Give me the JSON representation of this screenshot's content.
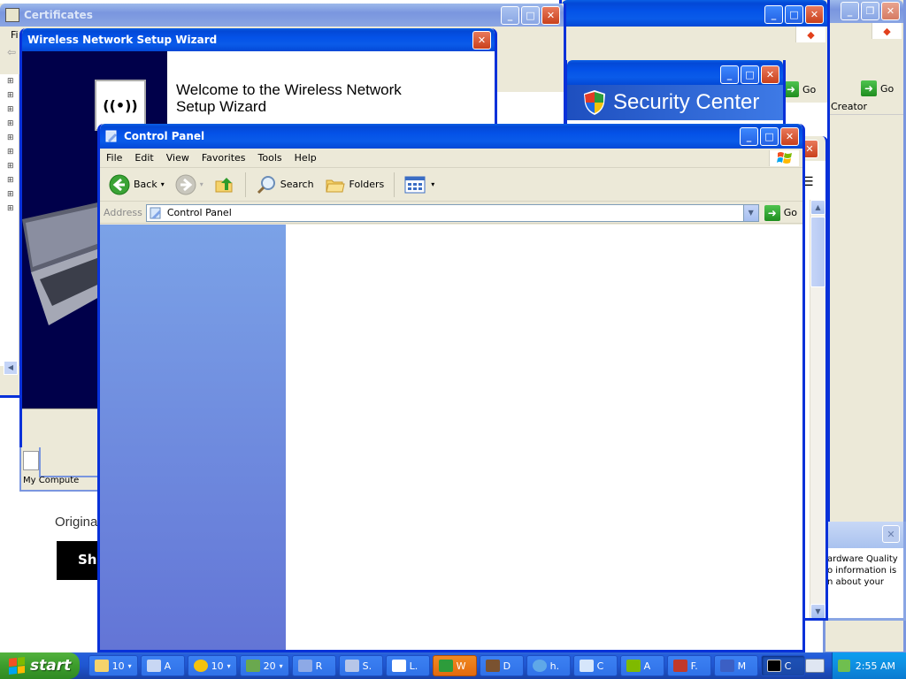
{
  "windows": {
    "certificates": {
      "title": "Certificates",
      "menu_first": "Fi"
    },
    "back_right_1": {
      "go_label": "Go",
      "creator_label": "Creator"
    },
    "security_center": {
      "title": "Security Center"
    },
    "wizard": {
      "title": "Wireless Network Setup Wizard",
      "heading": "Welcome to the Wireless Network Setup Wizard"
    },
    "hardware_popup": {
      "text": "ardware Quality\no information is\nn about your"
    },
    "behind": {
      "my_computer": "My Compute",
      "origina": "Origina",
      "sho": "Sho"
    },
    "control_panel": {
      "title": "Control Panel",
      "menu": [
        "File",
        "Edit",
        "View",
        "Favorites",
        "Tools",
        "Help"
      ],
      "toolbar": {
        "back": "Back",
        "search": "Search",
        "folders": "Folders"
      },
      "address_label": "Address",
      "address_value": "Control Panel",
      "go_label": "Go"
    }
  },
  "taskbar": {
    "start_label": "start",
    "tasks": [
      "10",
      "A",
      "10",
      "20",
      "R",
      "S.",
      "L.",
      "W",
      "D",
      "h.",
      "C",
      "A",
      "F.",
      "M",
      "C"
    ],
    "clock": "2:55 AM"
  },
  "colors": {
    "xp_blue": "#0831d9",
    "taskpane_top": "#7ba2e7",
    "taskpane_bottom": "#6375d6",
    "wizard_dark": "#00004a"
  }
}
